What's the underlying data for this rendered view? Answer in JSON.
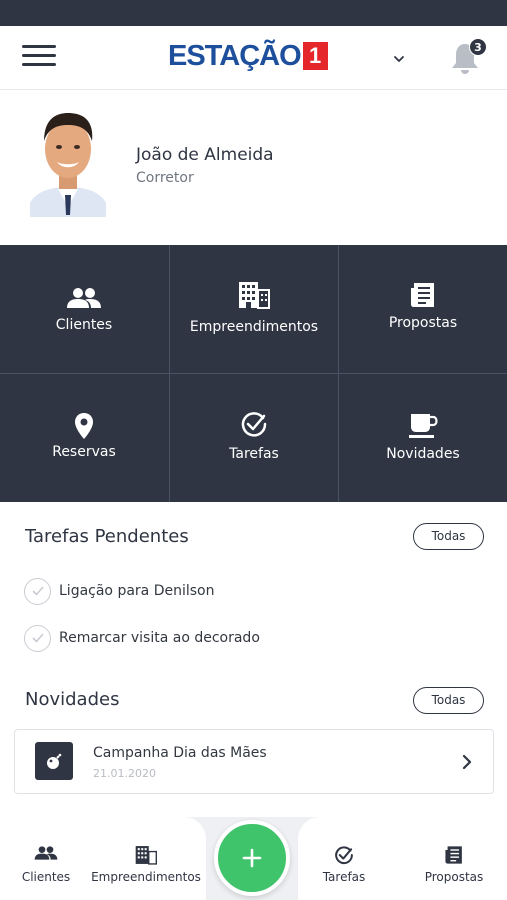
{
  "app": {
    "logo_text": "ESTAÇÃO",
    "logo_badge": "1",
    "notification_count": "3",
    "colors": {
      "primary_dark": "#2f3542",
      "brand_blue": "#1d4f9c",
      "brand_red": "#e5262b",
      "accent_green": "#3fc36b"
    }
  },
  "profile": {
    "name": "João de Almeida",
    "role": "Corretor"
  },
  "menu": {
    "clientes": {
      "label": "Clientes",
      "icon": "people-icon"
    },
    "empreendimentos": {
      "label": "Empreendimentos",
      "icon": "building-icon"
    },
    "propostas": {
      "label": "Propostas",
      "icon": "document-icon"
    },
    "reservas": {
      "label": "Reservas",
      "icon": "map-pin-icon"
    },
    "tarefas": {
      "label": "Tarefas",
      "icon": "check-circle-icon"
    },
    "novidades": {
      "label": "Novidades",
      "icon": "coffee-cup-icon"
    }
  },
  "tasks": {
    "title": "Tarefas Pendentes",
    "all_label": "Todas",
    "items": [
      {
        "text": "Ligação para Denilson"
      },
      {
        "text": "Remarcar visita ao decorado"
      }
    ]
  },
  "news": {
    "title": "Novidades",
    "all_label": "Todas",
    "items": [
      {
        "title": "Campanha Dia das Mães",
        "date": "21.01.2020"
      }
    ]
  },
  "bottom_nav": {
    "clientes": "Clientes",
    "empreendimentos": "Empreendimentos",
    "tarefas": "Tarefas",
    "propostas": "Propostas",
    "fab_icon": "plus-icon"
  }
}
